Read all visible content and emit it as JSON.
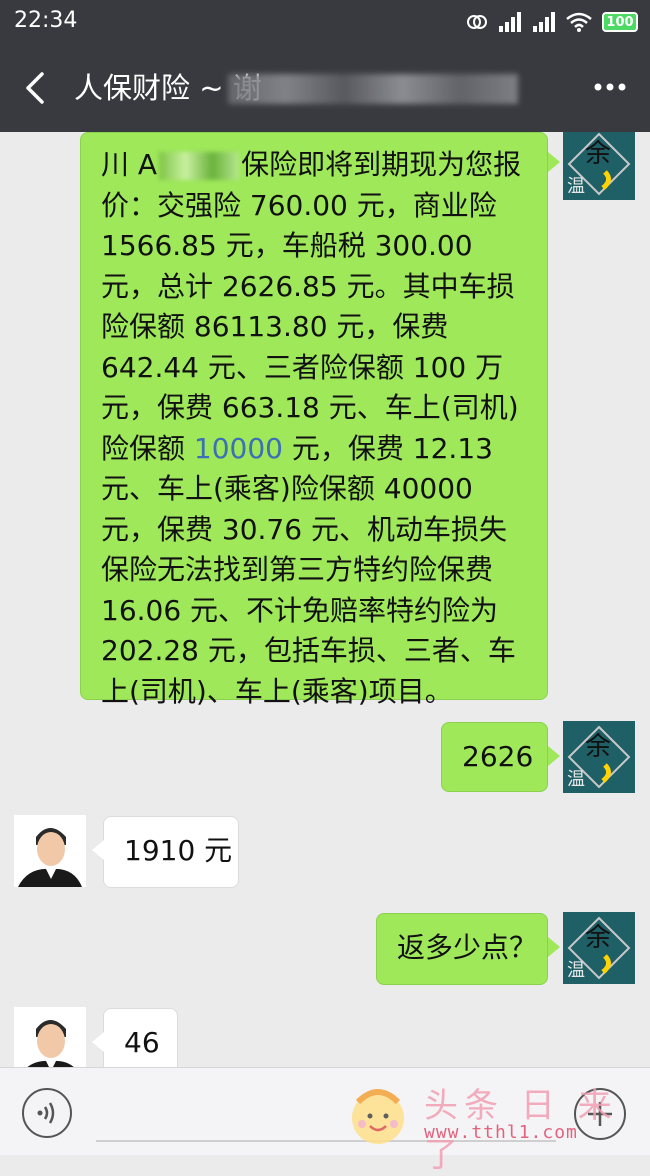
{
  "status_bar": {
    "time": "22:34",
    "battery": "100",
    "icons": [
      "sync-icon",
      "signal-icon",
      "signal-icon",
      "wifi-icon",
      "battery-icon"
    ]
  },
  "header": {
    "title": "人保财险 ~ 谢",
    "back_icon": "chevron-left-icon",
    "more_icon": "more-dots-icon"
  },
  "messages": [
    {
      "side": "out",
      "prefix": "川 A",
      "text_after_plate": "保险即将到期现为您报价：交强险 760.00 元，商业险 1566.85 元，车船税 300.00 元，总计 2626.85 元。其中车损险保额 86113.80 元，保费 642.44 元、三者险保额 100 万元，保费 663.18 元、车上(司机)险保额 ",
      "link_value": "10000",
      "text_after_link": " 元，保费 12.13 元、车上(乘客)险保额 40000 元，保费 30.76 元、机动车损失保险无法找到第三方特约险保费 16.06 元、不计免赔率特约险为 202.28 元，包括车损、三者、车上(司机)、车上(乘客)项目。"
    },
    {
      "side": "out",
      "text": "2626"
    },
    {
      "side": "in",
      "text": "1910 元"
    },
    {
      "side": "out",
      "text": "返多少点？"
    },
    {
      "side": "in",
      "text": "46"
    }
  ],
  "avatar_me_text": "温",
  "avatar_me_text2": "余",
  "bottom_bar": {
    "voice_icon": "voice-icon",
    "plus_icon": "plus-icon"
  },
  "watermark": {
    "text": "头条 日 来了",
    "url": "www.tthl1.com"
  },
  "colors": {
    "header_bg": "#393a3f",
    "chat_bg": "#ebebeb",
    "bubble_out": "#9ee85a",
    "bubble_in": "#ffffff",
    "link": "#3b6fb6"
  }
}
